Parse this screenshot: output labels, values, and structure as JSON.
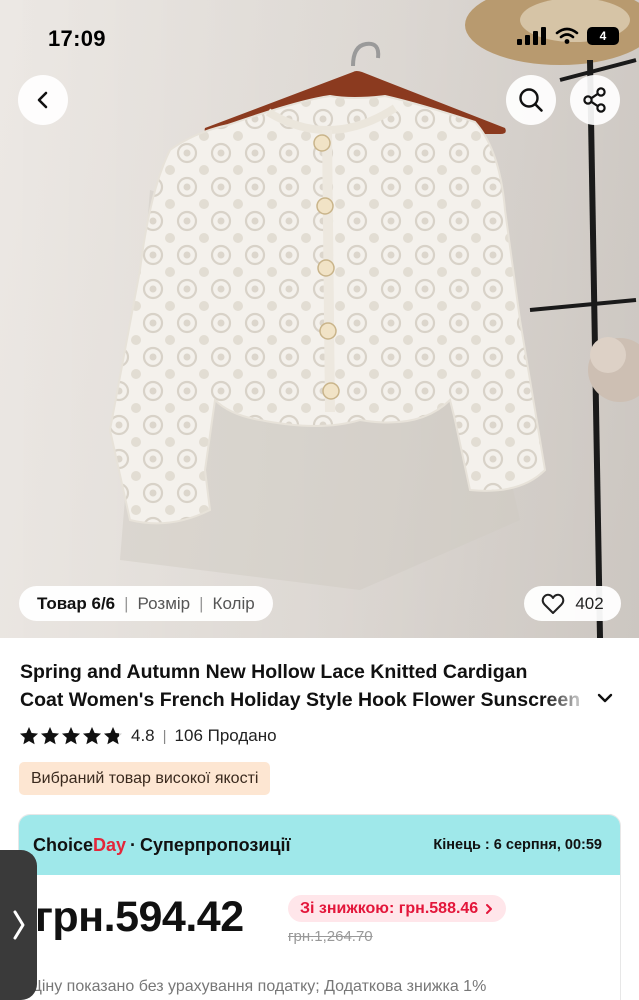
{
  "status_bar": {
    "time": "17:09",
    "battery": "4"
  },
  "header": {
    "back_icon": "chevron-left-icon",
    "search_icon": "search-icon",
    "share_icon": "share-icon"
  },
  "gallery": {
    "variant_bar": {
      "item_label": "Товар 6/6",
      "size_label": "Розмір",
      "color_label": "Колір"
    },
    "likes": "402"
  },
  "product": {
    "title_line1": "Spring and Autumn New Hollow Lace Knitted Cardigan",
    "title_line2": "Coat Women's French Holiday Style Hook Flower Sunscreen",
    "rating": "4.8",
    "stars": 4.8,
    "sold": "106 Продано",
    "quality_badge": "Вибраний товар високої якості"
  },
  "deal": {
    "brand_part1": "Choice",
    "brand_part2": "Day",
    "separator": "·",
    "label": "Суперпропозиції",
    "ends": "Кінець : 6 серпня, 00:59"
  },
  "pricing": {
    "price": "грн.594.42",
    "discount_chip": "Зі знижкою: грн.588.46",
    "old_price": "грн.1,264.70",
    "tax_note": "Ціну показано без урахування податку; Додаткова знижка 1%"
  },
  "colors": {
    "deal_header_bg": "#9fe8ea",
    "brand_red": "#e3263a",
    "quality_badge_bg": "#fde6d2",
    "discount_chip_bg": "#ffe6ea"
  }
}
